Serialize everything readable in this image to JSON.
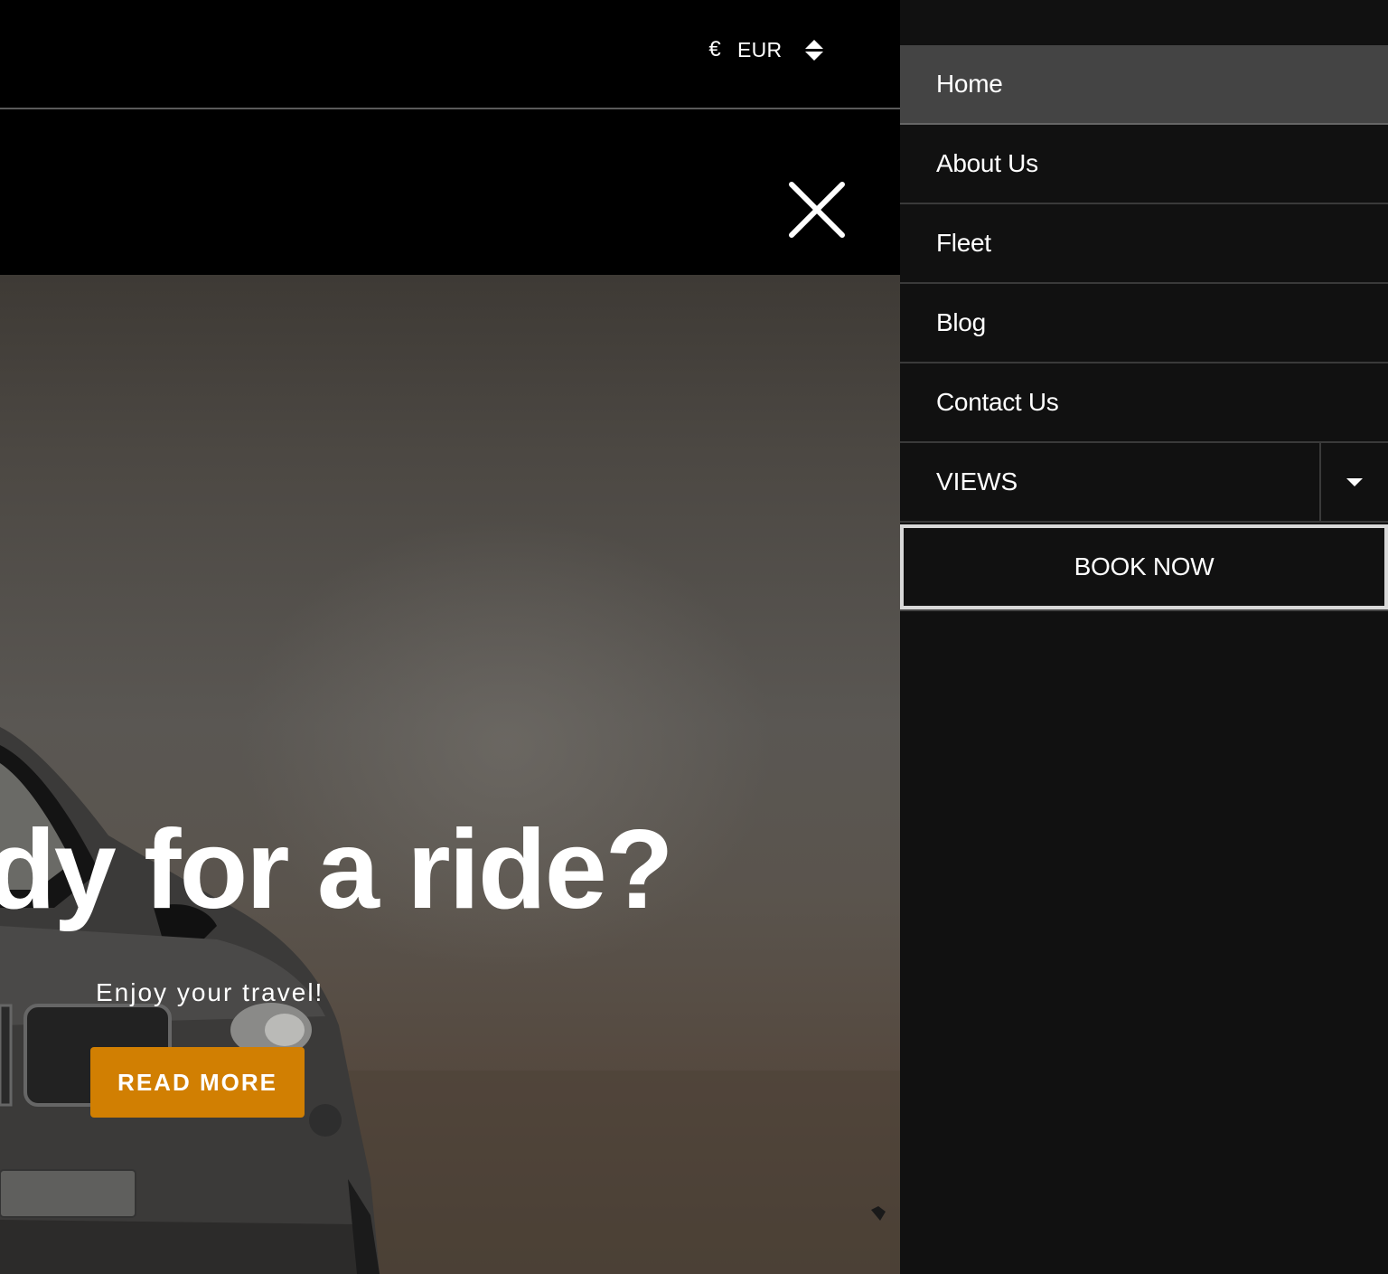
{
  "header": {
    "currency": {
      "symbol": "€",
      "code": "EUR",
      "icon": "sort-icon"
    },
    "close_icon": "close-icon"
  },
  "hero": {
    "title": "dy for a ride?",
    "subtitle": "Enjoy your travel!",
    "cta_label": "READ MORE",
    "accent_color": "#d17f02"
  },
  "side_menu": {
    "items": [
      {
        "label": "Home",
        "active": true
      },
      {
        "label": "About Us",
        "active": false
      },
      {
        "label": "Fleet",
        "active": false
      },
      {
        "label": "Blog",
        "active": false
      },
      {
        "label": "Contact Us",
        "active": false
      },
      {
        "label": "VIEWS",
        "active": false,
        "has_submenu": true
      }
    ],
    "submenu_toggle_icon": "caret-down-icon",
    "book_now_label": "BOOK NOW"
  }
}
